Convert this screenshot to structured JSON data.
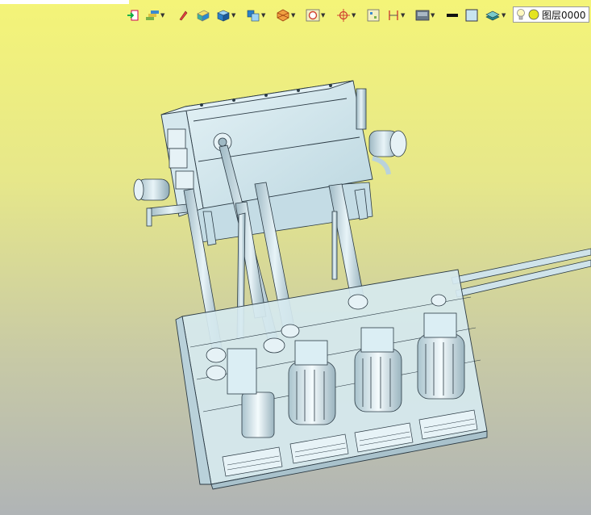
{
  "toolbar": {
    "tools": [
      {
        "name": "import-tool",
        "icon": "import-arrow-icon"
      },
      {
        "name": "assembly-tree-tool",
        "icon": "assembly-tree-icon"
      },
      {
        "name": "pen-tool",
        "icon": "pen-icon"
      },
      {
        "name": "solid-render-tool",
        "icon": "solid-box-icon"
      },
      {
        "name": "shaded-view-tool",
        "icon": "shaded-cube-icon"
      },
      {
        "name": "view-orientation-tool",
        "icon": "view-cube-icon"
      },
      {
        "name": "section-tool",
        "icon": "section-hexagon-icon"
      },
      {
        "name": "zoom-fit-tool",
        "icon": "zoom-fit-icon"
      },
      {
        "name": "target-tool",
        "icon": "crosshair-icon"
      },
      {
        "name": "grid-select-tool",
        "icon": "grid-select-icon"
      },
      {
        "name": "dimension-tool",
        "icon": "dimension-icon"
      },
      {
        "name": "display-mode-tool",
        "icon": "display-mode-icon"
      },
      {
        "name": "line-color-tool",
        "icon": "line-color-icon"
      },
      {
        "name": "fill-color-tool",
        "icon": "fill-color-icon"
      },
      {
        "name": "layer-stack-tool",
        "icon": "layer-stack-icon"
      }
    ],
    "layer": {
      "label": "图层0000",
      "icons": [
        "lightbulb-icon",
        "layer-color-icon"
      ]
    }
  },
  "viewport": {
    "background_top": "#f4f478",
    "background_bottom": "#b0b4b6",
    "model_color": "#cfe6ee",
    "line_color": "#2b3a44"
  }
}
